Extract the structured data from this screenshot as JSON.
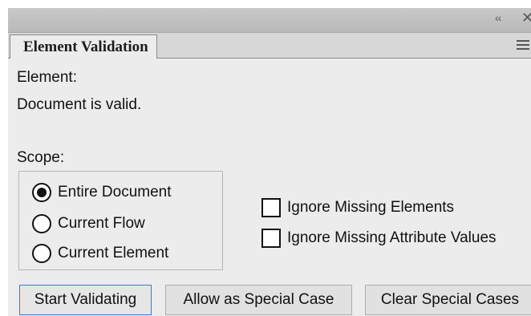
{
  "window": {
    "collapse_glyph": "‹‹",
    "close_glyph": "✕"
  },
  "tab": {
    "title": "Element Validation"
  },
  "labels": {
    "element": "Element:",
    "status": "Document is valid.",
    "scope": "Scope:"
  },
  "scope_options": [
    {
      "label": "Entire Document",
      "selected": true
    },
    {
      "label": "Current Flow",
      "selected": false
    },
    {
      "label": "Current Element",
      "selected": false
    }
  ],
  "options": [
    {
      "label": "Ignore Missing Elements",
      "checked": false
    },
    {
      "label": "Ignore Missing Attribute Values",
      "checked": false
    }
  ],
  "buttons": {
    "start": "Start Validating",
    "allow": "Allow as Special Case",
    "clear": "Clear Special Cases"
  },
  "colors": {
    "panel_bg": "#ececec",
    "focus_border": "#2f7fd1"
  },
  "icons": {
    "collapse": "double-chevron-left-icon",
    "close": "close-icon",
    "panel_menu": "hamburger-menu-icon"
  }
}
